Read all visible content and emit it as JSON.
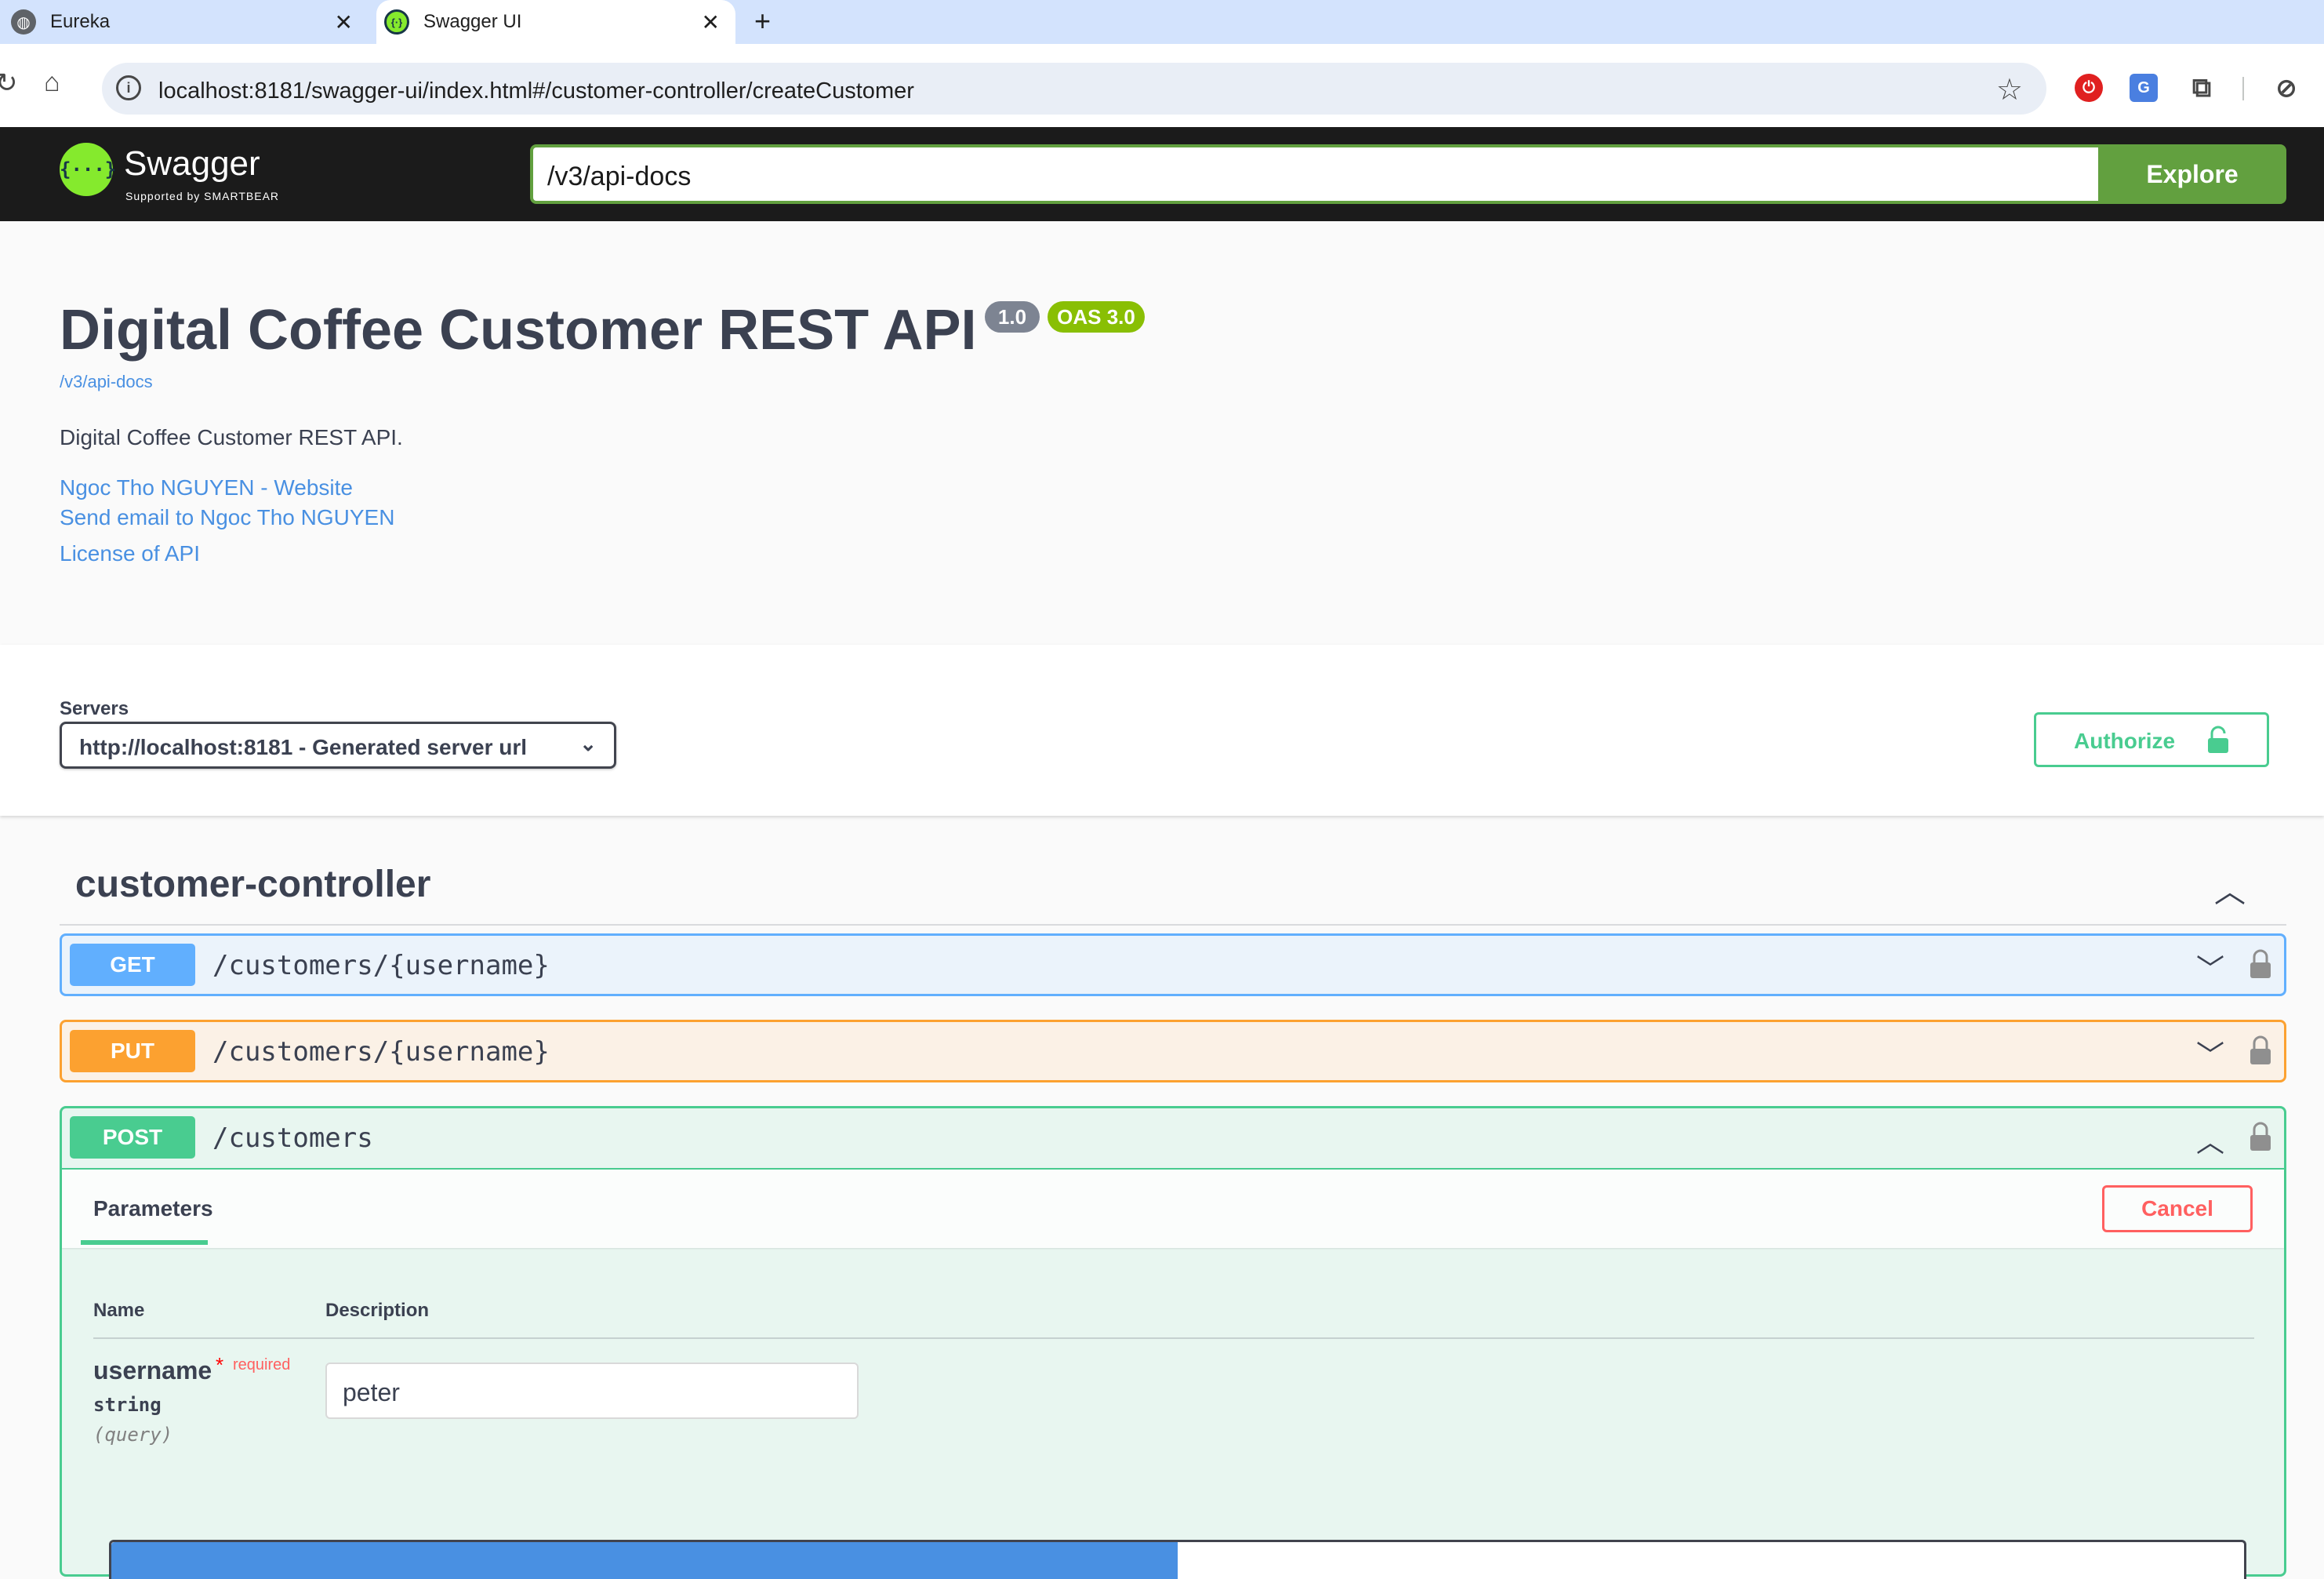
{
  "browser": {
    "tabs": [
      {
        "title": "Eureka",
        "icon": "globe-icon",
        "active": false
      },
      {
        "title": "Swagger UI",
        "icon": "swagger-favicon",
        "active": true
      }
    ],
    "url": "localhost:8181/swagger-ui/index.html#/customer-controller/createCustomer"
  },
  "topbar": {
    "logo_text": "Swagger",
    "logo_sub": "Supported by SMARTBEAR",
    "spec_url": "/v3/api-docs",
    "explore_label": "Explore"
  },
  "info": {
    "title": "Digital Coffee Customer REST API",
    "version": "1.0",
    "oas": "OAS 3.0",
    "spec_link": "/v3/api-docs",
    "description": "Digital Coffee Customer REST API.",
    "links": [
      "Ngoc Tho NGUYEN - Website",
      "Send email to Ngoc Tho NGUYEN",
      "License of API"
    ]
  },
  "servers": {
    "label": "Servers",
    "selected": "http://localhost:8181 - Generated server url",
    "authorize_label": "Authorize"
  },
  "controller": {
    "name": "customer-controller",
    "operations": [
      {
        "method": "GET",
        "path": "/customers/{username}",
        "expanded": false
      },
      {
        "method": "PUT",
        "path": "/customers/{username}",
        "expanded": false
      },
      {
        "method": "POST",
        "path": "/customers",
        "expanded": true
      }
    ]
  },
  "post_panel": {
    "tab_label": "Parameters",
    "cancel_label": "Cancel",
    "col_name": "Name",
    "col_description": "Description",
    "param": {
      "name": "username",
      "star": "*",
      "required": "required",
      "type": "string",
      "in": "(query)",
      "value": "peter"
    }
  },
  "colors": {
    "get": "#61affe",
    "put": "#fca130",
    "post": "#49cc90",
    "delete_cancel": "#ff6060",
    "explore": "#62a03f",
    "topbar": "#1b1b1b"
  }
}
